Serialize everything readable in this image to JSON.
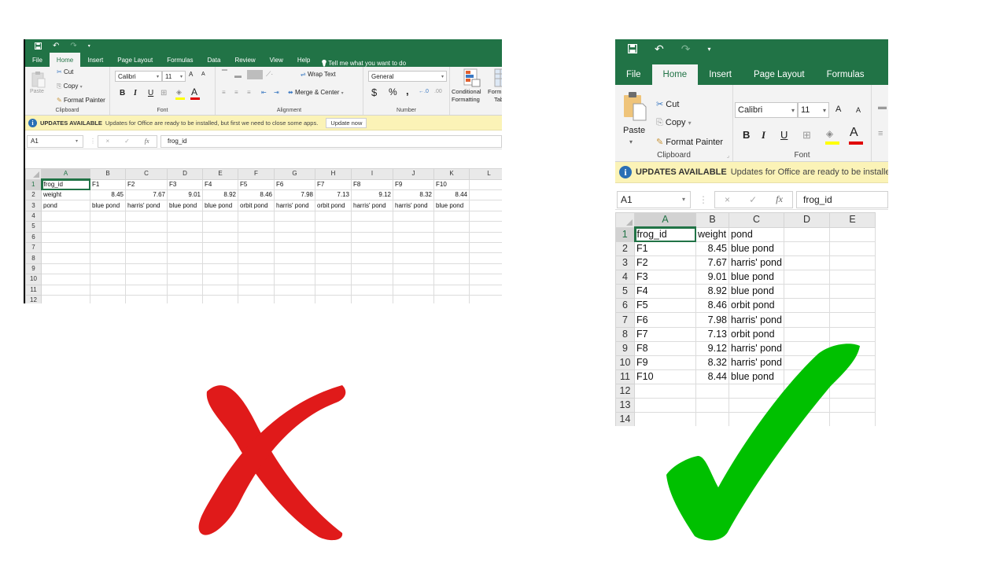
{
  "colors": {
    "excel_green": "#217346",
    "wrong_mark": "#e01a1a",
    "right_mark": "#00c000",
    "update_bar": "#fbf3b7",
    "info_blue": "#2a6fb5"
  },
  "shared": {
    "quick_access": {
      "save_icon": "save-icon",
      "undo_icon": "undo-icon",
      "redo_icon": "redo-icon",
      "customize_icon": "chevron-down-icon"
    },
    "ribbon": {
      "clipboard": {
        "paste": "Paste",
        "cut": "Cut",
        "copy": "Copy",
        "format_painter": "Format Painter",
        "label": "Clipboard"
      },
      "font": {
        "font_name": "Calibri",
        "font_size": "11",
        "bold": "B",
        "italic": "I",
        "underline": "U",
        "grow": "A",
        "shrink": "A",
        "font_color": "A",
        "label": "Font"
      },
      "alignment": {
        "wrap_text": "Wrap Text",
        "merge_center": "Merge & Center",
        "label": "Alignment"
      },
      "number": {
        "format": "General",
        "currency": "$",
        "percent": "%",
        "comma": ",",
        "label": "Number"
      },
      "styles": {
        "conditional_formatting_1": "Conditional",
        "conditional_formatting_2": "Formatting",
        "format_table_1": "Form",
        "format_table_2": "Tab"
      }
    },
    "update_bar": {
      "title": "UPDATES AVAILABLE",
      "message_full": "Updates for Office are ready to be installed, but first we need to close some apps.",
      "message_cropped": "Updates for Office are ready to be installed,",
      "button": "Update now"
    },
    "formula_bar": {
      "name_box": "A1",
      "cancel": "×",
      "enter": "✓",
      "fx": "fx",
      "value": "frog_id"
    }
  },
  "left_sheet": {
    "verdict": "wrong",
    "tabs": [
      "File",
      "Home",
      "Insert",
      "Page Layout",
      "Formulas",
      "Data",
      "Review",
      "View",
      "Help"
    ],
    "active_tab": "Home",
    "tell_me": "Tell me what you want to do",
    "columns": [
      "A",
      "B",
      "C",
      "D",
      "E",
      "F",
      "G",
      "H",
      "I",
      "J",
      "K",
      "L"
    ],
    "rows": [
      [
        "frog_id",
        "F1",
        "F2",
        "F3",
        "F4",
        "F5",
        "F6",
        "F7",
        "F8",
        "F9",
        "F10",
        ""
      ],
      [
        "weight",
        "8.45",
        "7.67",
        "9.01",
        "8.92",
        "8.46",
        "7.98",
        "7.13",
        "9.12",
        "8.32",
        "8.44",
        ""
      ],
      [
        "pond",
        "blue pond",
        "harris' pond",
        "blue pond",
        "blue pond",
        "orbit pond",
        "harris' pond",
        "orbit pond",
        "harris' pond",
        "harris' pond",
        "blue pond",
        ""
      ]
    ],
    "row_numbers": [
      "1",
      "2",
      "3",
      "4",
      "5",
      "6",
      "7",
      "8",
      "9",
      "10",
      "11",
      "12"
    ]
  },
  "right_sheet": {
    "verdict": "right",
    "tabs": [
      "File",
      "Home",
      "Insert",
      "Page Layout",
      "Formulas"
    ],
    "active_tab": "Home",
    "columns": [
      "A",
      "B",
      "C",
      "D",
      "E"
    ],
    "rows": [
      [
        "frog_id",
        "weight",
        "pond"
      ],
      [
        "F1",
        "8.45",
        "blue pond"
      ],
      [
        "F2",
        "7.67",
        "harris' pond"
      ],
      [
        "F3",
        "9.01",
        "blue pond"
      ],
      [
        "F4",
        "8.92",
        "blue pond"
      ],
      [
        "F5",
        "8.46",
        "orbit pond"
      ],
      [
        "F6",
        "7.98",
        "harris' pond"
      ],
      [
        "F7",
        "7.13",
        "orbit pond"
      ],
      [
        "F8",
        "9.12",
        "harris' pond"
      ],
      [
        "F9",
        "8.32",
        "harris' pond"
      ],
      [
        "F10",
        "8.44",
        "blue pond"
      ]
    ],
    "row_numbers": [
      "1",
      "2",
      "3",
      "4",
      "5",
      "6",
      "7",
      "8",
      "9",
      "10",
      "11",
      "12",
      "13",
      "14"
    ]
  }
}
